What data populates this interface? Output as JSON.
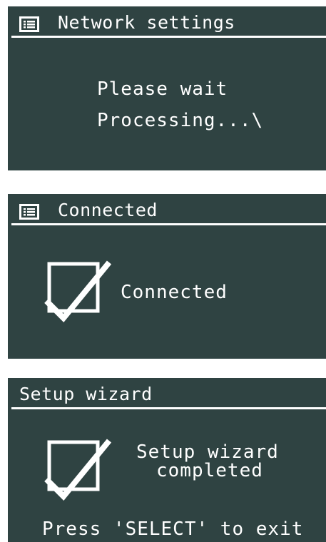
{
  "screens": [
    {
      "title": "Network settings",
      "title_icon": "menu-list-icon",
      "lines": [
        "Please wait",
        "Processing...\\"
      ]
    },
    {
      "title": "Connected",
      "title_icon": "menu-list-icon",
      "status_icon": "checkbox-tick-icon",
      "message": "Connected"
    },
    {
      "title": "Setup wizard",
      "status_icon": "checkbox-tick-icon",
      "message_lines": [
        "Setup wizard",
        "completed"
      ],
      "footer": "Press 'SELECT' to exit"
    }
  ],
  "colors": {
    "screen_background": "#2f4342",
    "text": "#ffffff",
    "page_background": "#ffffff"
  }
}
